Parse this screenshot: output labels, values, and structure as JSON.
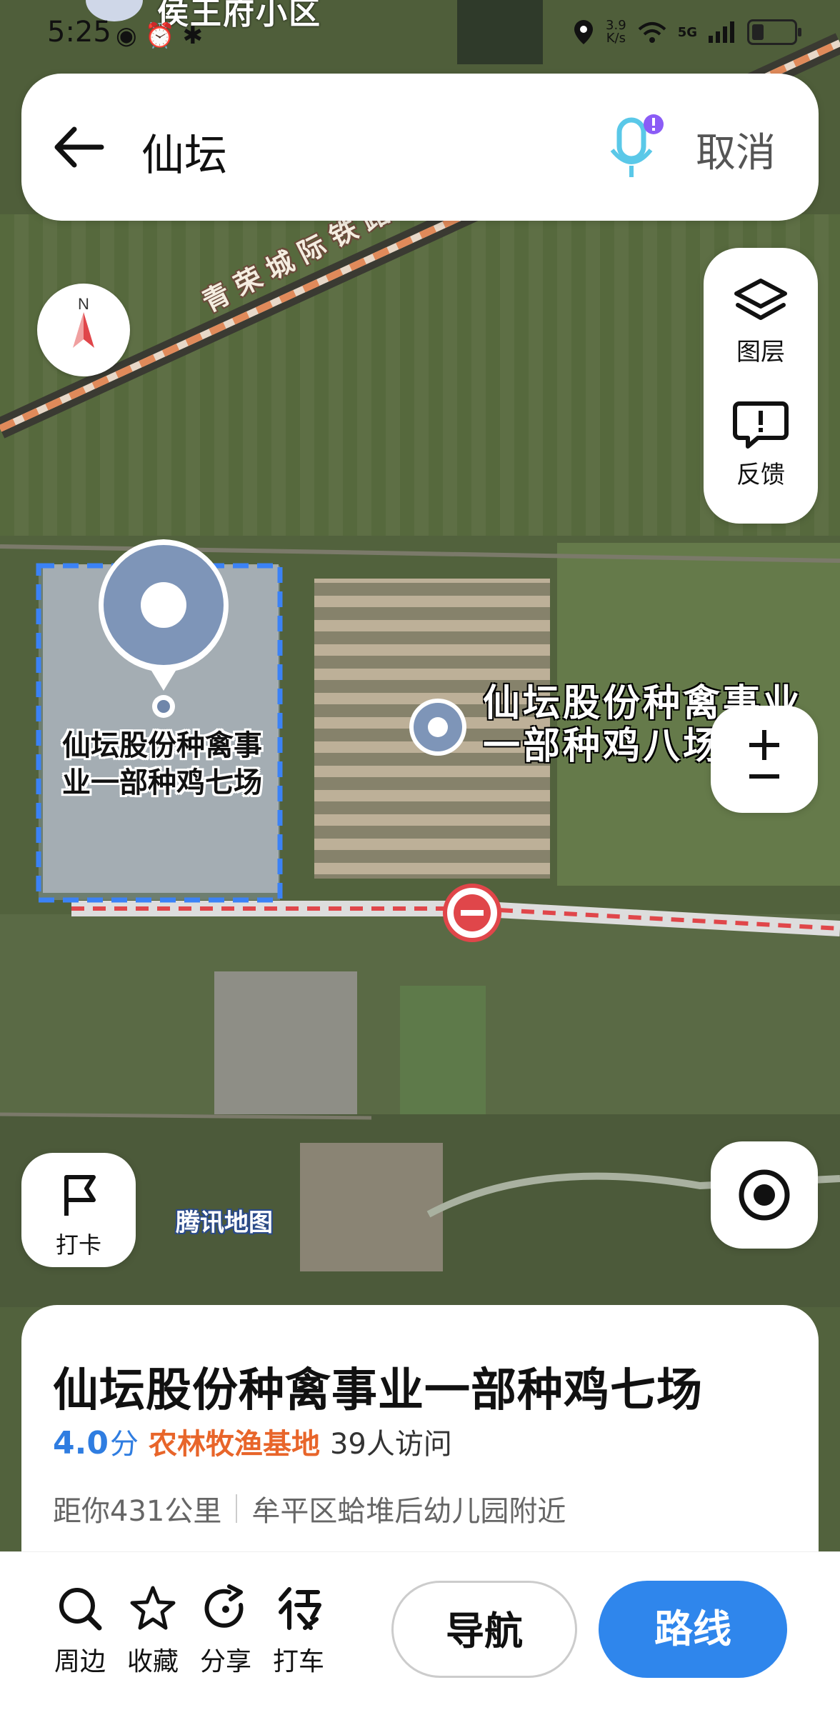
{
  "status_bar": {
    "time": "5:25",
    "peek_text": "侯王府小区",
    "speed_value": "3.9",
    "speed_unit": "K/s",
    "network": "5G"
  },
  "search": {
    "query": "仙坛",
    "cancel_label": "取消"
  },
  "side_panel": {
    "layers_label": "图层",
    "feedback_label": "反馈"
  },
  "map": {
    "railway_label": "青荣城际铁路",
    "selected_poi_name": "仙坛股份种禽事业一部种鸡七场",
    "selected_poi_line1": "仙坛股份种禽事",
    "selected_poi_line2": "业一部种鸡七场",
    "other_poi_line1": "仙坛股份种禽事业",
    "other_poi_line2": "一部种鸡八场",
    "watermark": "腾讯地图"
  },
  "checkin": {
    "label": "打卡"
  },
  "place_card": {
    "title": "仙坛股份种禽事业一部种鸡七场",
    "rating": "4.0",
    "rating_unit": "分",
    "category": "农林牧渔基地",
    "visits": "39人访问",
    "distance": "距你431公里",
    "address": "牟平区蛤堆后幼儿园附近"
  },
  "actions": {
    "nearby": "周边",
    "favorite": "收藏",
    "share": "分享",
    "taxi": "打车",
    "navigate": "导航",
    "route": "路线"
  },
  "colors": {
    "accent_blue": "#2f86ec",
    "rating_blue": "#2f7de1",
    "category_orange": "#e8652a",
    "closed_road_red": "#e0464a"
  }
}
